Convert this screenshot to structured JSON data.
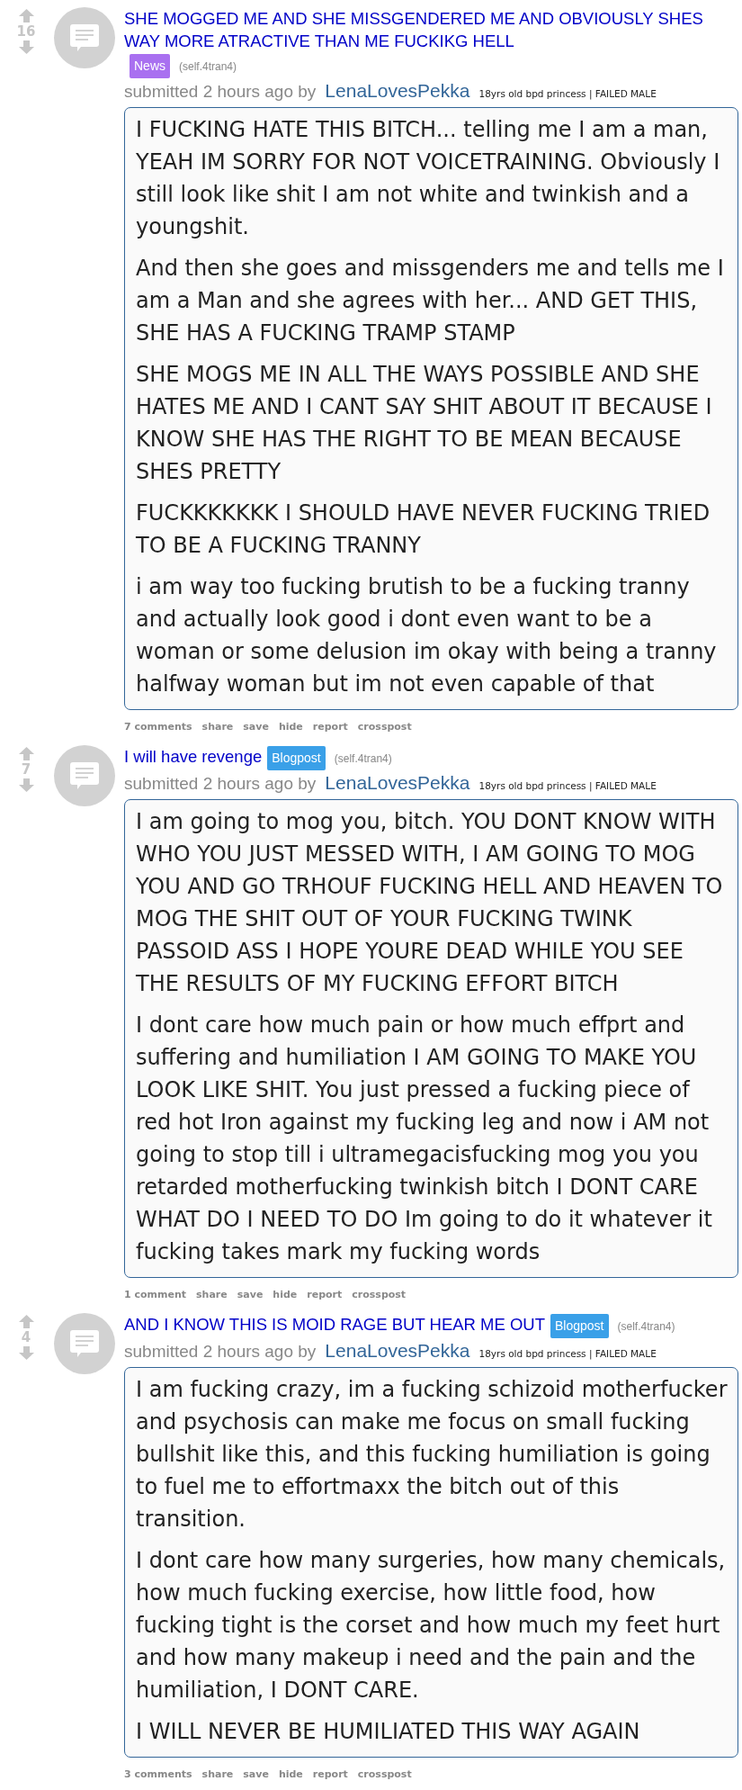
{
  "posts": [
    {
      "score": "16",
      "title": "SHE MOGGED ME AND SHE MISSGENDERED ME AND OBVIOUSLY SHES WAY MORE ATRACTIVE THAN ME FUCKIKG HELL",
      "flair": {
        "text": "News",
        "color": "#a970f0"
      },
      "domain": "(self.4tran4)",
      "submitted": "submitted 2 hours ago by",
      "author": "LenaLovesPekka",
      "user_flair": "18yrs old bpd princess | FAILED MALE",
      "paragraphs": [
        "I FUCKING HATE THIS BITCH... telling me I am a man, YEAH IM SORRY FOR NOT VOICETRAINING. Obviously I still look like shit I am not white and twinkish and a youngshit.",
        "And then she goes and missgenders me and tells me I am a Man and she agrees with her... AND GET THIS, SHE HAS A FUCKING TRAMP STAMP",
        "SHE MOGS ME IN ALL THE WAYS POSSIBLE AND SHE HATES ME AND I CANT SAY SHIT ABOUT IT BECAUSE I KNOW SHE HAS THE RIGHT TO BE MEAN BECAUSE SHES PRETTY",
        "FUCKKKKKKK I SHOULD HAVE NEVER FUCKING TRIED TO BE A FUCKING TRANNY",
        "i am way too fucking brutish to be a fucking tranny and actually look good i dont even want to be a woman or some delusion im okay with being a tranny halfway woman but im not even capable of that"
      ],
      "buttons": [
        "7 comments",
        "share",
        "save",
        "hide",
        "report",
        "crosspost"
      ]
    },
    {
      "score": "7",
      "title": "I will have revenge",
      "flair": {
        "text": "Blogpost",
        "color": "#3aa0e8"
      },
      "domain": "(self.4tran4)",
      "submitted": "submitted 2 hours ago by",
      "author": "LenaLovesPekka",
      "user_flair": "18yrs old bpd princess | FAILED MALE",
      "paragraphs": [
        "I am going to mog you, bitch. YOU DONT KNOW WITH WHO YOU JUST MESSED WITH, I AM GOING TO MOG YOU AND GO TRHOUF FUCKING HELL AND HEAVEN TO MOG THE SHIT OUT OF YOUR FUCKING TWINK PASSOID ASS I HOPE YOURE DEAD WHILE YOU SEE THE RESULTS OF MY FUCKING EFFORT BITCH",
        "I dont care how much pain or how much effprt and suffering and humiliation I AM GOING TO MAKE YOU LOOK LIKE SHIT. You just pressed a fucking piece of red hot Iron against my fucking leg and now i AM not going to stop till i ultramegacisfucking mog you you retarded motherfucking twinkish bitch I DONT CARE WHAT DO I NEED TO DO Im going to do it whatever it fucking takes mark my fucking words"
      ],
      "buttons": [
        "1 comment",
        "share",
        "save",
        "hide",
        "report",
        "crosspost"
      ]
    },
    {
      "score": "4",
      "title": "AND I KNOW THIS IS MOID RAGE BUT HEAR ME OUT",
      "flair": {
        "text": "Blogpost",
        "color": "#3aa0e8"
      },
      "domain": "(self.4tran4)",
      "submitted": "submitted 2 hours ago by",
      "author": "LenaLovesPekka",
      "user_flair": "18yrs old bpd princess | FAILED MALE",
      "paragraphs": [
        "I am fucking crazy, im a fucking schizoid motherfucker and psychosis can make me focus on small fucking bullshit like this, and this fucking humiliation is going to fuel me to effortmaxx the bitch out of this transition.",
        "I dont care how many surgeries, how many chemicals, how much fucking exercise, how little food, how fucking tight is the corset and how much my feet hurt and how many makeup i need and the pain and the humiliation, I DONT CARE.",
        "I WILL NEVER BE HUMILIATED THIS WAY AGAIN"
      ],
      "buttons": [
        "3 comments",
        "share",
        "save",
        "hide",
        "report",
        "crosspost"
      ]
    }
  ]
}
